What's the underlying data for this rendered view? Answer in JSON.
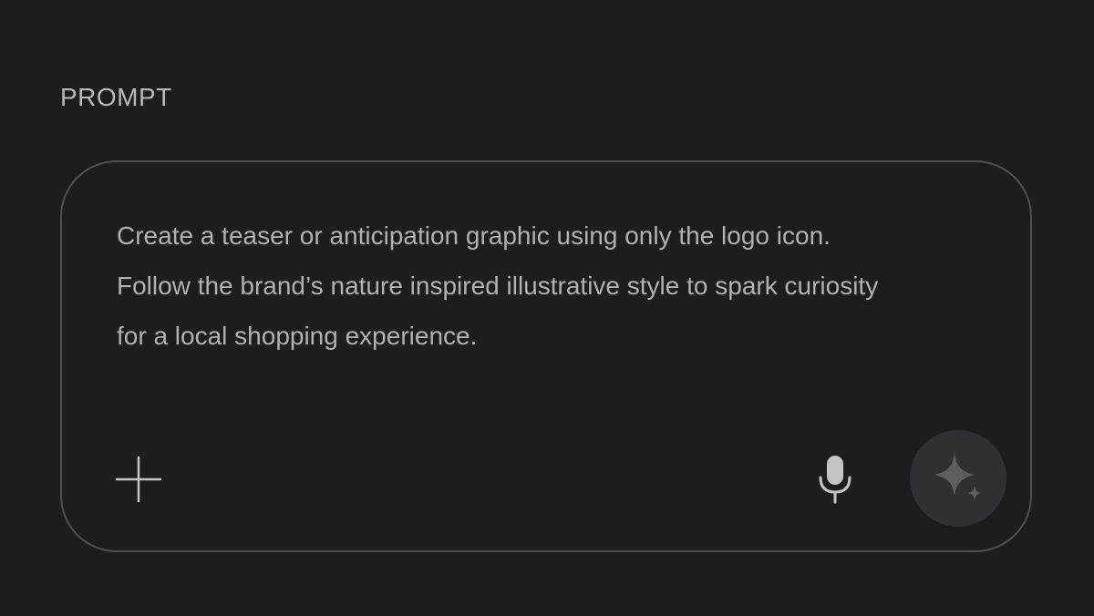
{
  "section": {
    "label": "PROMPT"
  },
  "prompt": {
    "text": "Create a teaser or anticipation graphic using only the logo icon.\nFollow the brand’s nature inspired illustrative style to spark curiosity\nfor a local shopping experience."
  },
  "toolbar": {
    "add_icon": "plus-icon",
    "mic_icon": "microphone-icon",
    "generate_icon": "sparkle-icon"
  },
  "colors": {
    "background": "#1c1d1f",
    "border": "#4d4f53",
    "text": "#aeb1b5",
    "icon": "#c3c5c8",
    "generate_button_bg": "#2f3033",
    "generate_icon": "#5c5e62"
  }
}
